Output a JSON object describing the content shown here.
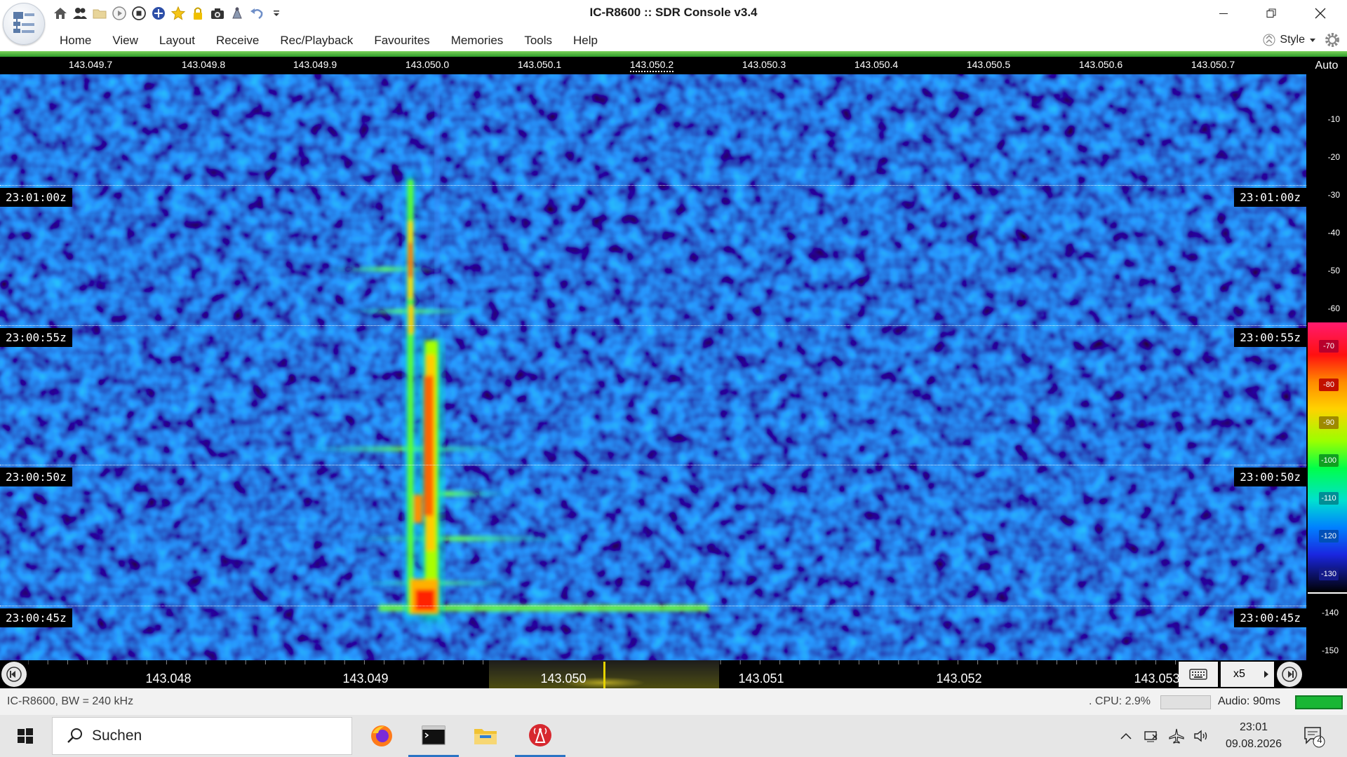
{
  "window": {
    "title": "IC-R8600 :: SDR Console v3.4"
  },
  "menu": {
    "items": [
      "Home",
      "View",
      "Layout",
      "Receive",
      "Rec/Playback",
      "Favourites",
      "Memories",
      "Tools",
      "Help"
    ],
    "style_label": "Style"
  },
  "spectrum": {
    "top_ticks": [
      "143.049.7",
      "143.049.8",
      "143.049.9",
      "143.050.0",
      "143.050.1",
      "143.050.2",
      "143.050.3",
      "143.050.4",
      "143.050.5",
      "143.050.6",
      "143.050.7"
    ],
    "auto_label": "Auto"
  },
  "waterfall": {
    "time_labels": [
      "23:01:00z",
      "23:00:55z",
      "23:00:50z",
      "23:00:45z"
    ]
  },
  "db_scale": {
    "labels": [
      "-10",
      "-20",
      "-30",
      "-40",
      "-50",
      "-60",
      "-70",
      "-80",
      "-90",
      "-100",
      "-110",
      "-120",
      "-130",
      "-140",
      "-150"
    ]
  },
  "frequency": {
    "labels": [
      "143.048",
      "143.049",
      "143.050",
      "143.051",
      "143.052",
      "143.053"
    ],
    "zoom": "x5"
  },
  "status": {
    "radio": "IC-R8600, BW = 240 kHz",
    "cpu": ". CPU: 2.9%",
    "audio": "Audio: 90ms"
  },
  "taskbar": {
    "search_placeholder": "Suchen",
    "time": "23:01",
    "date": "09.08.2026",
    "notifications": "4"
  },
  "colors": {
    "waterfall_bg": "#1426c8",
    "signal_hot": "#ff3000",
    "active_accent": "#2b74c4",
    "audio_level": "#19b634"
  }
}
